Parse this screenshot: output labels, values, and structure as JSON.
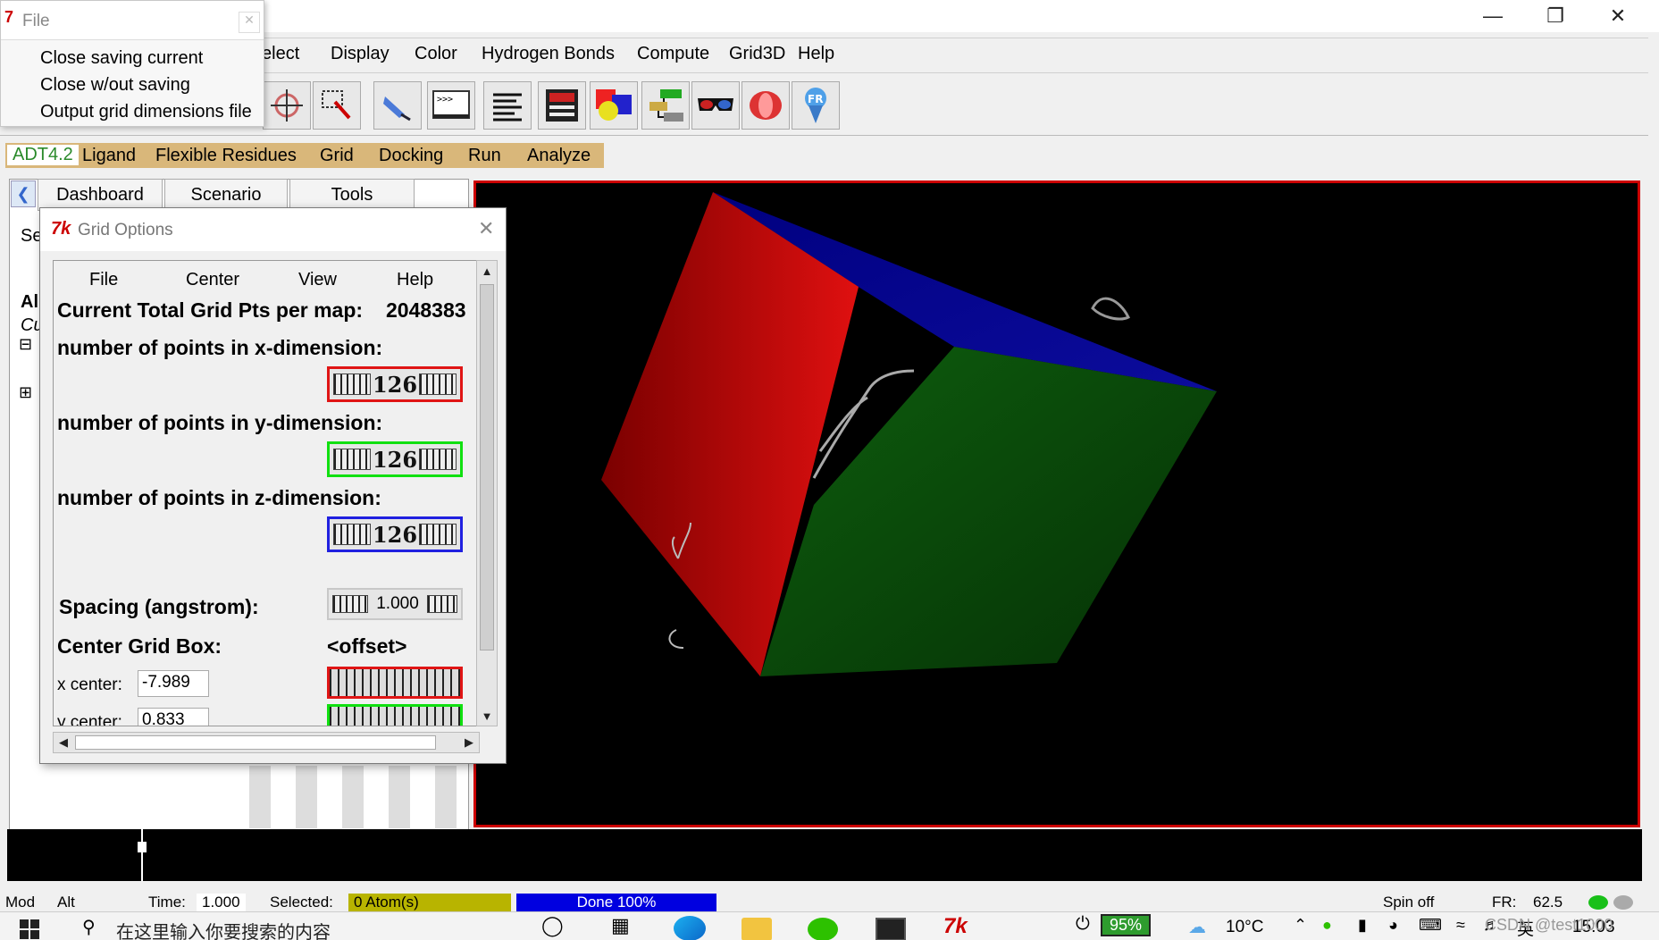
{
  "app": {
    "menu": [
      "elect",
      "Display",
      "Color",
      "Hydrogen Bonds",
      "Compute",
      "Grid3D",
      "Help"
    ],
    "adt_menu": [
      "ADT4.2",
      "Ligand",
      "Flexible Residues",
      "Grid",
      "Docking",
      "Run",
      "Analyze"
    ],
    "tabs": [
      "Dashboard",
      "Scenario",
      "Tools"
    ],
    "left_partial": [
      "Se",
      "All",
      "Cu",
      "⊟",
      "⊞"
    ]
  },
  "file_menu": {
    "title": "File",
    "items": [
      "Close saving current",
      "Close w/out saving",
      "Output grid dimensions file"
    ]
  },
  "grid_options": {
    "title": "Grid Options",
    "menu": [
      "File",
      "Center",
      "View",
      "Help"
    ],
    "total_label": "Current Total Grid Pts per map:",
    "total_value": "2048383",
    "x_label": "number of points in x-dimension:",
    "x_value": "126",
    "y_label": "number of points in y-dimension:",
    "y_value": "126",
    "z_label": "number of points in z-dimension:",
    "z_value": "126",
    "spacing_label": "Spacing (angstrom):",
    "spacing_value": "1.000",
    "center_label": "Center Grid Box:",
    "offset_label": "<offset>",
    "x_center_label": "x center:",
    "x_center_value": "-7.989",
    "y_center_label": "y center:",
    "y_center_value": "0.833"
  },
  "status": {
    "mod": "Mod",
    "alt": "Alt",
    "time_label": "Time:",
    "time_value": "1.000",
    "selected_label": "Selected:",
    "selected_value": "0 Atom(s)",
    "done": "Done 100%",
    "spin": "Spin off",
    "fr_label": "FR:",
    "fr_value": "62.5"
  },
  "taskbar": {
    "search_placeholder": "在这里输入你要搜索的内容",
    "battery": "95%",
    "temperature": "10°C",
    "ime": "英",
    "time": "15:03",
    "watermark": "CSDN @test1000"
  },
  "colors": {
    "x_dial": "#e01515",
    "y_dial": "#10e010",
    "z_dial": "#2020e0",
    "adt_bar": "#d9b77a",
    "viewer_border": "#c00000"
  }
}
